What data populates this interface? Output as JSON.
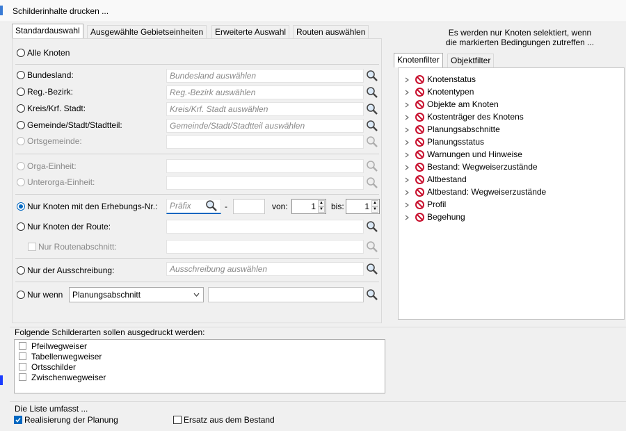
{
  "window": {
    "title": "Schilderinhalte drucken ..."
  },
  "tabs": [
    "Standardauswahl",
    "Ausgewählte Gebietseinheiten",
    "Erweiterte Auswahl",
    "Routen auswählen"
  ],
  "options": {
    "alle_knoten": "Alle Knoten",
    "bundesland": {
      "label": "Bundesland:",
      "placeholder": "Bundesland auswählen"
    },
    "regbezirk": {
      "label": "Reg.-Bezirk:",
      "placeholder": "Reg.-Bezirk auswählen"
    },
    "kreis": {
      "label": "Kreis/Krf. Stadt:",
      "placeholder": "Kreis/Krf. Stadt auswählen"
    },
    "gemeinde": {
      "label": "Gemeinde/Stadt/Stadtteil:",
      "placeholder": "Gemeinde/Stadt/Stadtteil auswählen"
    },
    "ortsgemeinde": {
      "label": "Ortsgemeinde:"
    },
    "orga": {
      "label": "Orga-Einheit:"
    },
    "unterorga": {
      "label": "Unterorga-Einheit:"
    },
    "erhebung": {
      "label": "Nur Knoten mit den Erhebungs-Nr.:",
      "prefix_placeholder": "Präfix",
      "dash": "-",
      "von_label": "von:",
      "von_value": "1",
      "bis_label": "bis:",
      "bis_value": "1"
    },
    "route": {
      "label": "Nur Knoten der Route:"
    },
    "routenabschnitt": {
      "label": "Nur Routenabschnitt:"
    },
    "ausschreibung": {
      "label": "Nur der Ausschreibung:",
      "placeholder": "Ausschreibung auswählen"
    },
    "nurwenn": {
      "label": "Nur wenn",
      "selected": "Planungsabschnitt"
    }
  },
  "filter": {
    "info_line1": "Es werden nur Knoten selektiert, wenn",
    "info_line2": "die markierten Bedingungen zutreffen ...",
    "tabs": [
      "Knotenfilter",
      "Objektfilter"
    ],
    "items": [
      "Knotenstatus",
      "Knotentypen",
      "Objekte am Knoten",
      "Kostenträger des Knotens",
      "Planungsabschnitte",
      "Planungsstatus",
      "Warnungen und Hinweise",
      "Bestand: Wegweiserzustände",
      "Altbestand",
      "Altbestand: Wegweiserzustände",
      "Profil",
      "Begehung"
    ]
  },
  "schilder": {
    "label": "Folgende Schilderarten sollen ausgedruckt werden:",
    "items": [
      "Pfeilwegweiser",
      "Tabellenwegweiser",
      "Ortsschilder",
      "Zwischenwegweiser"
    ]
  },
  "liste": {
    "label": "Die Liste umfasst ...",
    "realisierung": "Realisierung der Planung",
    "ersatz": "Ersatz aus dem Bestand"
  },
  "colors": {
    "accent": "#0067c0",
    "forbidden": "#c8102e"
  }
}
